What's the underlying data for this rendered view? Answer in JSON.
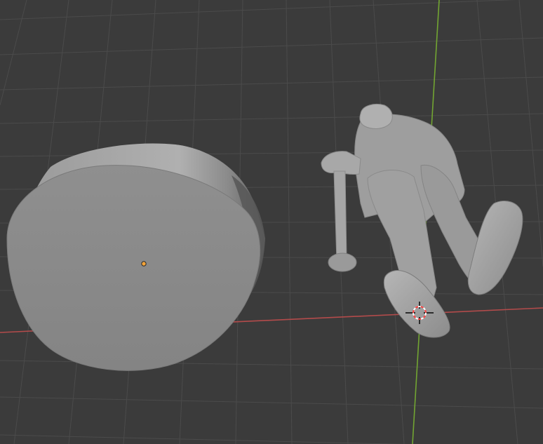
{
  "viewport": {
    "background_color": "#3b3b3b",
    "grid_color": "#4a4a4a",
    "x_axis_color": "#b34b4b",
    "y_axis_color": "#6fa42f"
  },
  "objects": {
    "cylinder": {
      "color": "#8a8a8a",
      "side_color": "#a2a2a2"
    },
    "figure": {
      "color": "#9b9b9b"
    },
    "origin_marker": {
      "color": "#f2a33a"
    }
  },
  "cursor": {
    "icon": "3d-cursor-icon",
    "ring_color_a": "#ff4040",
    "ring_color_b": "#ffffff"
  }
}
